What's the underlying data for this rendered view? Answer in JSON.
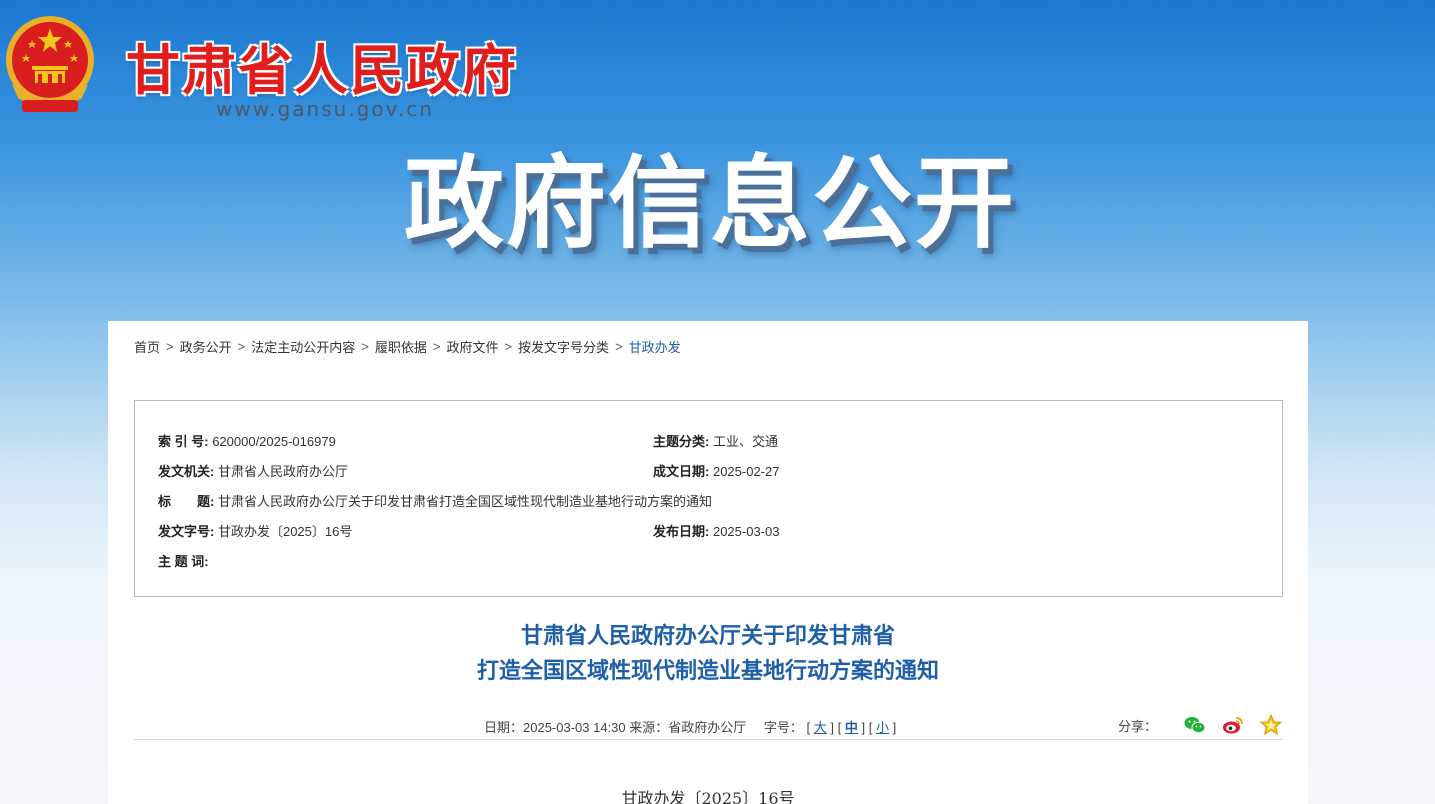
{
  "header": {
    "site_name": "甘肃省人民政府",
    "site_url": "www.gansu.gov.cn",
    "banner_title": "政府信息公开"
  },
  "breadcrumb": {
    "items": [
      "首页",
      "政务公开",
      "法定主动公开内容",
      "履职依据",
      "政府文件",
      "按发文字号分类",
      "甘政办发"
    ],
    "separator": ">"
  },
  "info": {
    "index_label": "索  引  号:",
    "index_value": "620000/2025-016979",
    "category_label": "主题分类:",
    "category_value": "工业、交通",
    "issuer_label": "发文机关:",
    "issuer_value": "甘肃省人民政府办公厅",
    "created_label": "成文日期:",
    "created_value": "2025-02-27",
    "title_label": "标　　题:",
    "title_value": "甘肃省人民政府办公厅关于印发甘肃省打造全国区域性现代制造业基地行动方案的通知",
    "docno_label": "发文字号:",
    "docno_value": "甘政办发〔2025〕16号",
    "published_label": "发布日期:",
    "published_value": "2025-03-03",
    "keywords_label": "主  题  词:",
    "keywords_value": ""
  },
  "article": {
    "title_line1": "甘肃省人民政府办公厅关于印发甘肃省",
    "title_line2": "打造全国区域性现代制造业基地行动方案的通知",
    "meta_date": "日期：2025-03-03 14:30 来源：省政府办公厅",
    "font_size_label": "字号：",
    "font_large": "大",
    "font_medium": "中",
    "font_small": "小",
    "share_label": "分享：",
    "doc_number": "甘政办发〔2025〕16号"
  },
  "colors": {
    "accent": "#1e5fa8",
    "site_name": "#e11d1d",
    "wechat": "#22b038",
    "weibo": "#e6162d",
    "favorite": "#f5c518"
  },
  "icons": [
    "national-emblem-icon",
    "wechat-icon",
    "weibo-icon",
    "star-icon"
  ]
}
